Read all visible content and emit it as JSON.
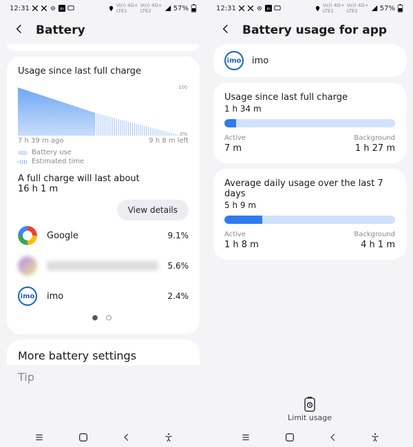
{
  "status": {
    "time": "12:31",
    "battery_pct": "57%"
  },
  "left": {
    "title": "Battery",
    "usage_card": {
      "heading": "Usage since last full charge",
      "x_left": "7 h 39 m ago",
      "x_right": "9 h 8 m left",
      "y_top": "100",
      "y_bottom": "0%",
      "legend_use": "Battery use",
      "legend_est": "Estimated time",
      "full_line1": "A full charge will last about",
      "full_line2": "16 h 1 m",
      "view_details": "View details",
      "apps": [
        {
          "name": "Google",
          "pct": "9.1%",
          "icon": "google"
        },
        {
          "name": "",
          "pct": "5.6%",
          "icon": "blur"
        },
        {
          "name": "imo",
          "pct": "2.4%",
          "icon": "imo"
        }
      ]
    },
    "more": "More battery settings",
    "tip": "Tip"
  },
  "right": {
    "title": "Battery usage for app",
    "app_name": "imo",
    "card1": {
      "heading": "Usage since last full charge",
      "total": "1 h 34 m",
      "active_lbl": "Active",
      "active_val": "7 m",
      "bg_lbl": "Background",
      "bg_val": "1 h 27 m",
      "fill_pct": 7
    },
    "card2": {
      "heading": "Average daily usage over the last 7 days",
      "total": "5 h 9 m",
      "active_lbl": "Active",
      "active_val": "1 h 8 m",
      "bg_lbl": "Background",
      "bg_val": "4 h 1 m",
      "fill_pct": 22
    },
    "limit": "Limit usage"
  },
  "chart_data": {
    "type": "area",
    "title": "Usage since last full charge",
    "x": [
      "7 h 39 m ago",
      "now",
      "9 h 8 m left"
    ],
    "y": [
      100,
      57,
      0
    ],
    "ylim": [
      0,
      100
    ],
    "xlabel": "",
    "ylabel": "%",
    "series": [
      {
        "name": "Battery use",
        "segment": "7 h 39 m ago → now",
        "style": "solid"
      },
      {
        "name": "Estimated time",
        "segment": "now → 9 h 8 m left",
        "style": "hatched"
      }
    ],
    "note": "Straight-line discharge from 100% to 57% over 7 h 39 m, projected to 0% over 9 h 8 m"
  }
}
